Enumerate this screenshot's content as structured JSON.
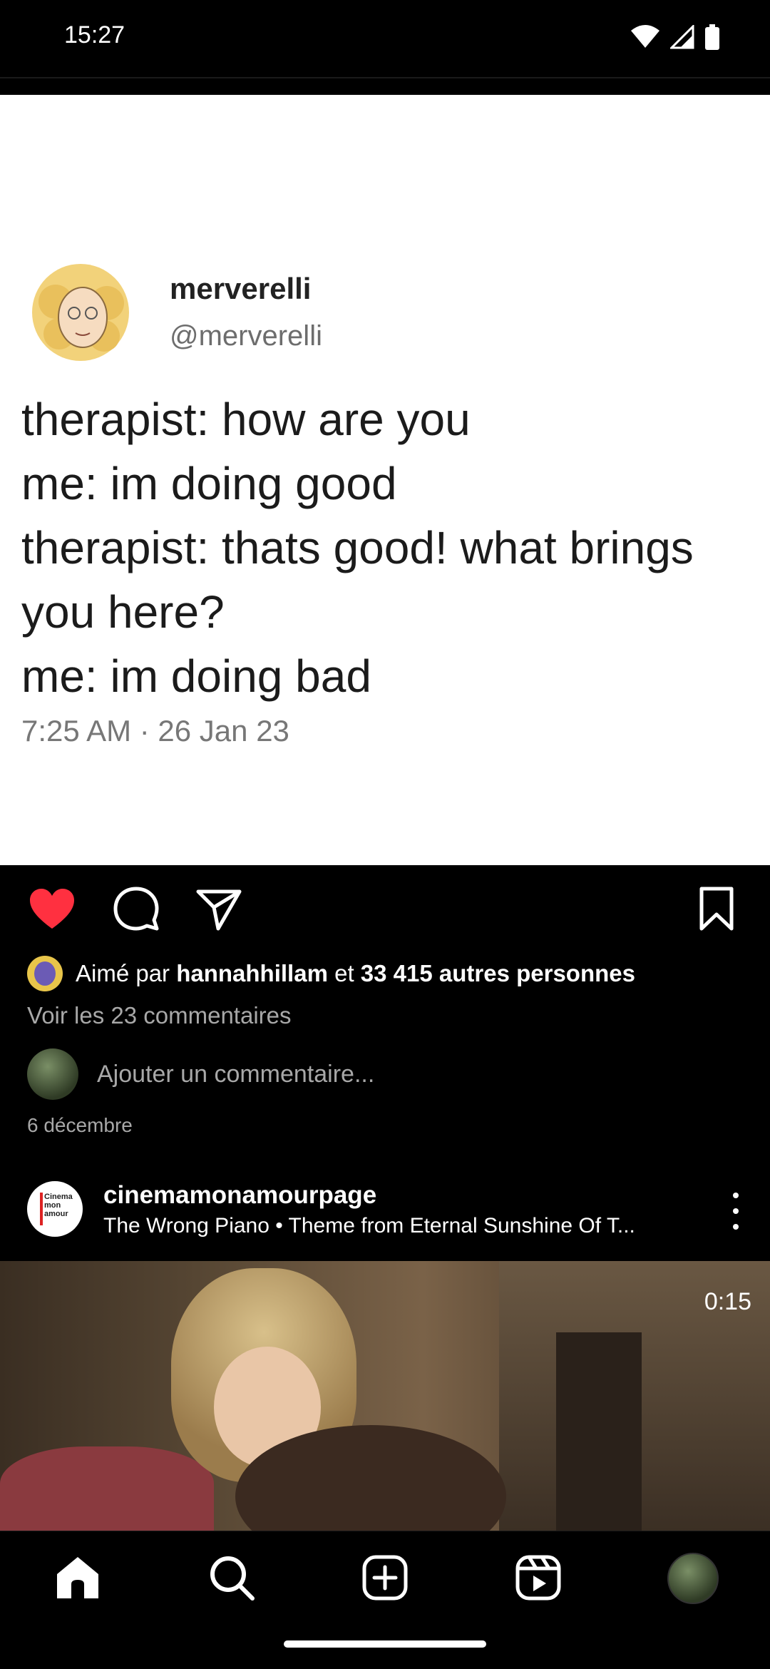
{
  "status_bar": {
    "time": "15:27"
  },
  "post": {
    "tweet": {
      "name": "merverelli",
      "handle": "@merverelli",
      "lines": [
        "therapist: how are you",
        "me: im doing good",
        "therapist: thats good! what brings",
        "you here?",
        "me: im doing bad"
      ],
      "timestamp": "7:25 AM · 26 Jan 23"
    },
    "likes": {
      "prefix": "Aimé par ",
      "user": "hannahhillam",
      "middle": " et ",
      "others": "33 415 autres personnes"
    },
    "view_comments": "Voir les 23 commentaires",
    "add_comment_placeholder": "Ajouter un commentaire...",
    "date": "6 décembre",
    "liked": true
  },
  "next_post": {
    "username": "cinemamonamourpage",
    "audio": "The Wrong Piano • Theme from Eternal Sunshine Of T...",
    "avatar_text": "Cinema mon amour",
    "video_time": "0:15"
  },
  "colors": {
    "like_red": "#ff3040",
    "background": "#000000",
    "muted_text": "#a8a8a8"
  },
  "icons": {
    "like": "heart-filled-icon",
    "comment": "comment-bubble-icon",
    "share": "paper-plane-icon",
    "save": "bookmark-icon",
    "home": "home-icon",
    "search": "search-icon",
    "create": "plus-square-icon",
    "reels": "reels-icon"
  }
}
